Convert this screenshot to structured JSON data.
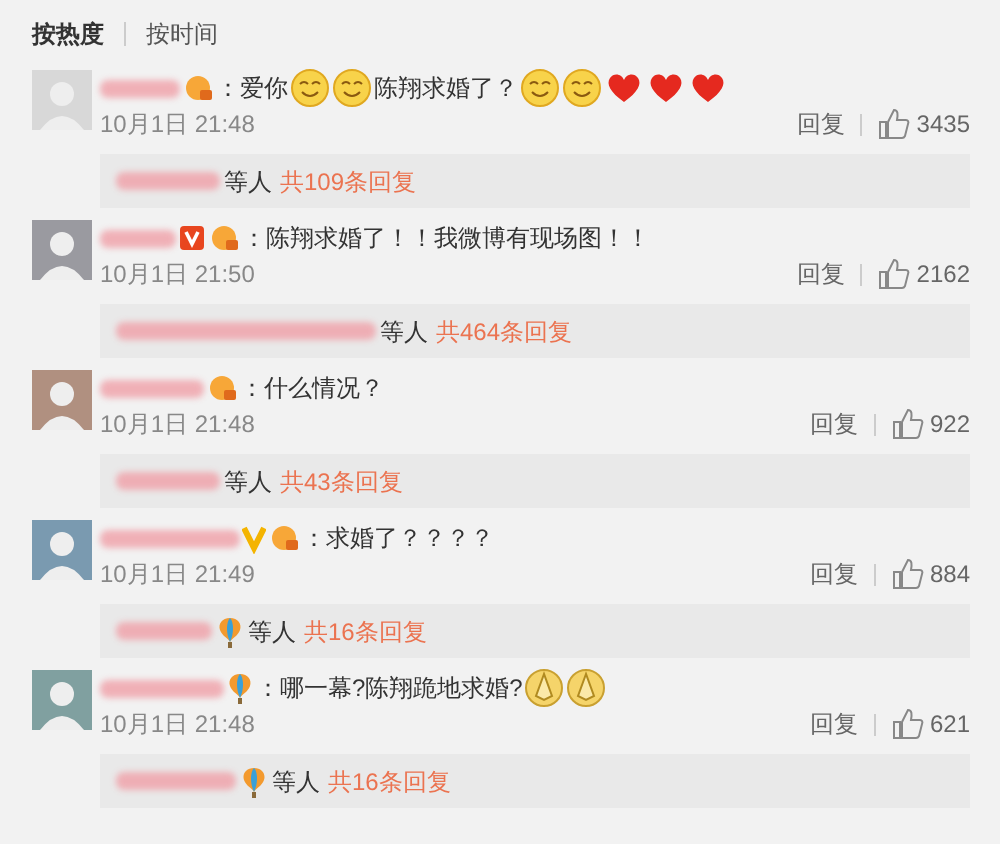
{
  "sort_tabs": [
    {
      "label": "按热度",
      "selected": true
    },
    {
      "label": "按时间",
      "selected": false
    }
  ],
  "comments": [
    {
      "badges": [
        {
          "kind": "vip"
        }
      ],
      "content": [
        {
          "kind": "text",
          "text": "：爱你"
        },
        {
          "kind": "smile"
        },
        {
          "kind": "smile"
        },
        {
          "kind": "text",
          "text": "陈翔求婚了？"
        },
        {
          "kind": "smile"
        },
        {
          "kind": "smile"
        },
        {
          "kind": "heart"
        },
        {
          "kind": "heart"
        },
        {
          "kind": "heart"
        }
      ],
      "time": "10月1日 21:48",
      "reply": "回复",
      "likes": "3435",
      "replies": {
        "suffix": "等人",
        "count": "共109条回复"
      }
    },
    {
      "badges": [
        {
          "kind": "verified"
        },
        {
          "kind": "vip"
        }
      ],
      "content": [
        {
          "kind": "text",
          "text": "：陈翔求婚了！！我微博有现场图！！"
        }
      ],
      "time": "10月1日 21:50",
      "reply": "回复",
      "likes": "2162",
      "replies": {
        "suffix": "等人",
        "count": "共464条回复"
      }
    },
    {
      "badges": [
        {
          "kind": "vip"
        }
      ],
      "content": [
        {
          "kind": "text",
          "text": "：什么情况？"
        }
      ],
      "time": "10月1日 21:48",
      "reply": "回复",
      "likes": "922",
      "replies": {
        "suffix": "等人",
        "count": "共43条回复"
      }
    },
    {
      "badges": [
        {
          "kind": "yellow-v"
        },
        {
          "kind": "vip"
        }
      ],
      "content": [
        {
          "kind": "text",
          "text": "：求婚了？？？？"
        }
      ],
      "time": "10月1日 21:49",
      "reply": "回复",
      "likes": "884",
      "replies": {
        "badges": [
          {
            "kind": "balloon"
          }
        ],
        "suffix": "等人",
        "count": "共16条回复"
      }
    },
    {
      "badges": [
        {
          "kind": "balloon"
        }
      ],
      "content": [
        {
          "kind": "text",
          "text": "：哪一幕?陈翔跪地求婚?"
        },
        {
          "kind": "pray"
        },
        {
          "kind": "pray"
        }
      ],
      "time": "10月1日 21:48",
      "reply": "回复",
      "likes": "621",
      "replies": {
        "badges": [
          {
            "kind": "balloon"
          }
        ],
        "suffix": "等人",
        "count": "共16条回复"
      }
    }
  ]
}
